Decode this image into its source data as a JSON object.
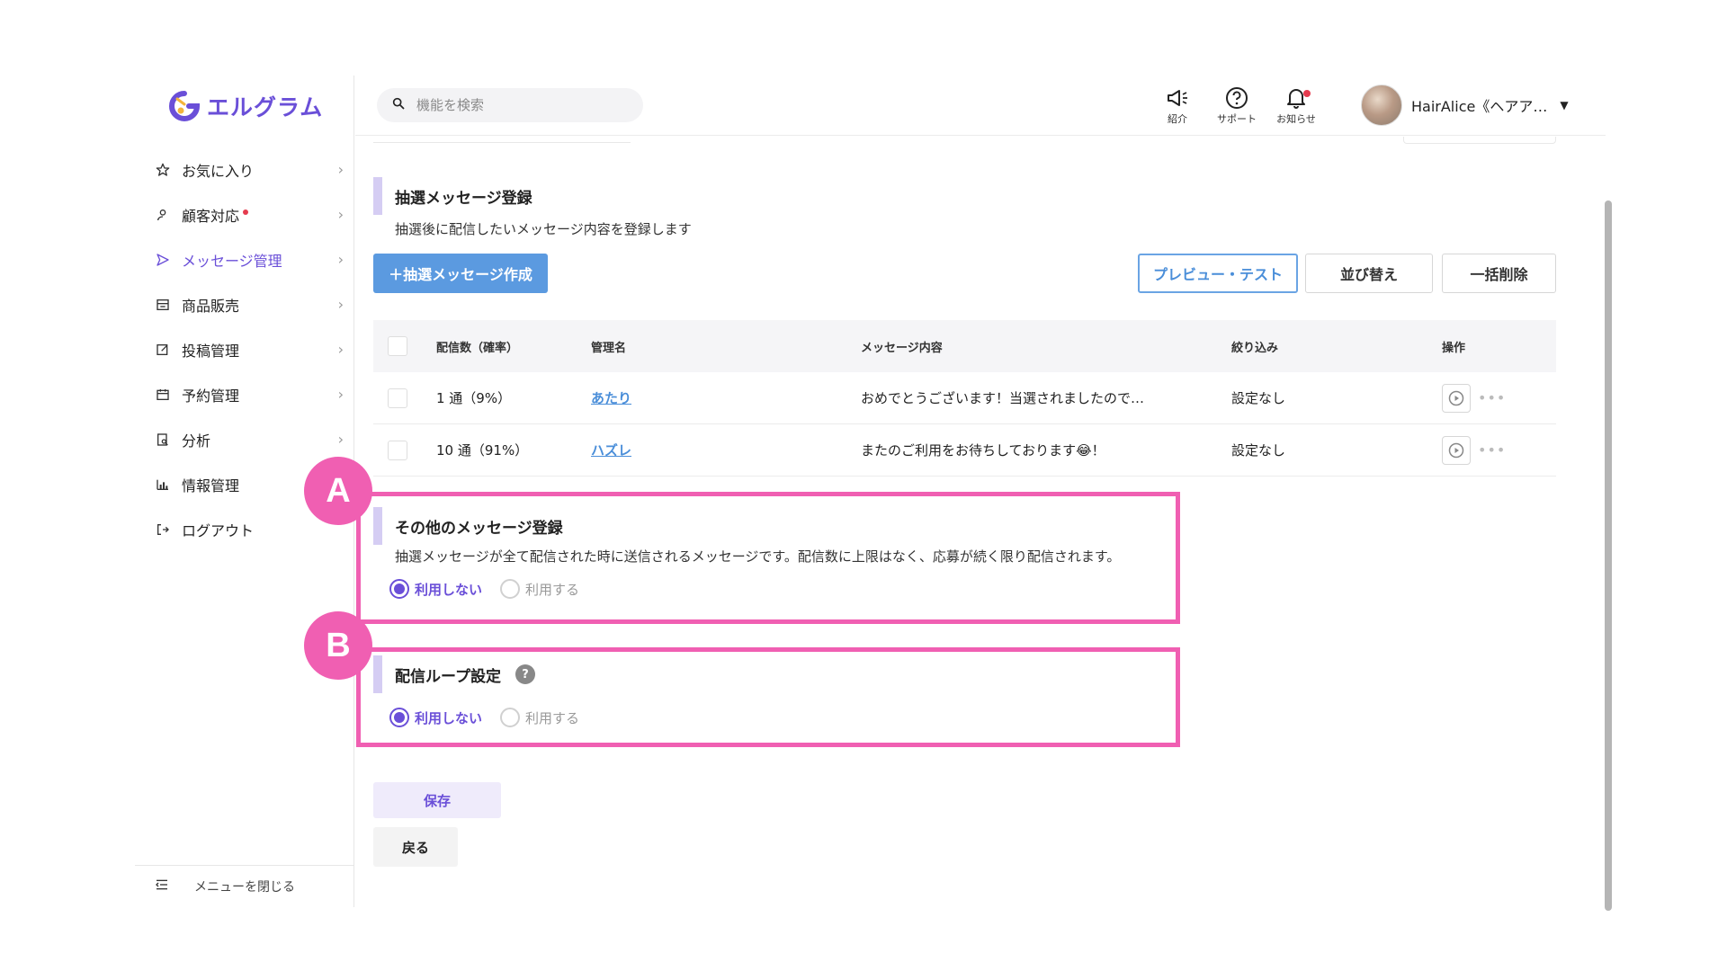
{
  "colors": {
    "accent": "#6a4fd8",
    "primary_button": "#5b9ae0",
    "annotation": "#f05fb2",
    "link": "#4a8ed9"
  },
  "logo": {
    "text": "エルグラム"
  },
  "sidebar": {
    "items": [
      {
        "label": "お気に入り",
        "icon": "star-icon",
        "active": false,
        "dot": false
      },
      {
        "label": "顧客対応",
        "icon": "user-icon",
        "active": false,
        "dot": true
      },
      {
        "label": "メッセージ管理",
        "icon": "send-icon",
        "active": true,
        "dot": false
      },
      {
        "label": "商品販売",
        "icon": "store-icon",
        "active": false,
        "dot": false
      },
      {
        "label": "投稿管理",
        "icon": "edit-icon",
        "active": false,
        "dot": false
      },
      {
        "label": "予約管理",
        "icon": "calendar-icon",
        "active": false,
        "dot": false
      },
      {
        "label": "分析",
        "icon": "analysis-icon",
        "active": false,
        "dot": false
      },
      {
        "label": "情報管理",
        "icon": "bar-chart-icon",
        "active": false,
        "dot": false
      },
      {
        "label": "ログアウト",
        "icon": "logout-icon",
        "active": false,
        "dot": false
      }
    ],
    "close_menu": "メニューを閉じる"
  },
  "header": {
    "search_placeholder": "機能を検索",
    "intro_label": "紹介",
    "support_label": "サポート",
    "notice_label": "お知らせ",
    "user_name": "HairAlice《ヘアア…"
  },
  "lottery": {
    "title": "抽選メッセージ登録",
    "description": "抽選後に配信したいメッセージ内容を登録します",
    "create_button": "＋抽選メッセージ作成",
    "preview_button": "プレビュー・テスト",
    "sort_button": "並び替え",
    "bulk_delete_button": "一括削除",
    "columns": [
      "配信数（確率）",
      "管理名",
      "メッセージ内容",
      "絞り込み",
      "操作"
    ],
    "rows": [
      {
        "count": "1 通（9%）",
        "name": "あたり",
        "message": "おめでとうございます！当選されましたので…",
        "filter": "設定なし"
      },
      {
        "count": "10 通（91%）",
        "name": "ハズレ",
        "message": "またのご利用をお待ちしております😂！",
        "filter": "設定なし"
      }
    ]
  },
  "other": {
    "title": "その他のメッセージ登録",
    "description": "抽選メッセージが全て配信された時に送信されるメッセージです。配信数に上限はなく、応募が続く限り配信されます。",
    "option_off": "利用しない",
    "option_on": "利用する"
  },
  "loop": {
    "title": "配信ループ設定",
    "help": "?",
    "option_off": "利用しない",
    "option_on": "利用する"
  },
  "annotations": {
    "a": "A",
    "b": "B"
  },
  "footer": {
    "save": "保存",
    "back": "戻る"
  }
}
